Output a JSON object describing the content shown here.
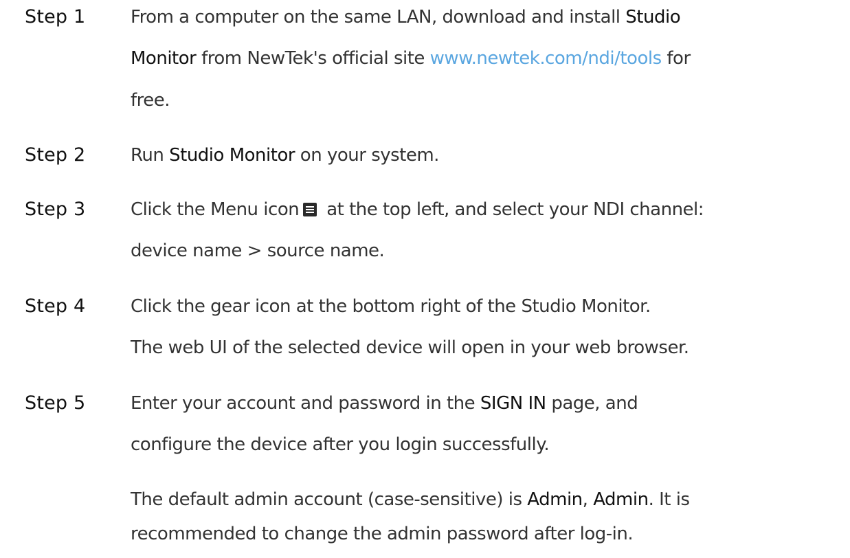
{
  "steps": [
    {
      "label": "Step 1",
      "line1_a": "From a computer on the same LAN, download and install ",
      "line1_b": "Studio",
      "line2_a": "Monitor",
      "line2_b": " from NewTek's official site ",
      "line2_link": "www.newtek.com/ndi/tools",
      "line2_c": " for",
      "line3": "free."
    },
    {
      "label": "Step 2",
      "line1_a": "Run ",
      "line1_b": "Studio Monitor",
      "line1_c": " on your system."
    },
    {
      "label": "Step 3",
      "line1_a": "Click the Menu icon",
      "menu_icon": "menu-icon",
      "line1_b": "at the top left, and select your NDI channel:",
      "line2": "device name > source name."
    },
    {
      "label": "Step 4",
      "line1": "Click the gear icon at the bottom right of the Studio Monitor.",
      "line2": "The web UI of the selected device will open in your web browser."
    },
    {
      "label": "Step 5",
      "line1_a": "Enter your account and password in the ",
      "line1_b": "SIGN IN",
      "line1_c": " page, and",
      "line2": "configure the device after you login successfully.",
      "line3_a": "The default admin account (case-sensitive) is ",
      "line3_b": "Admin",
      "line3_c": ", ",
      "line3_d": "Admin",
      "line3_e": ". It is",
      "line4": "recommended to change the admin password after log-in."
    }
  ],
  "colors": {
    "text": "#333333",
    "label": "#111111",
    "link": "#5aa6e0"
  }
}
